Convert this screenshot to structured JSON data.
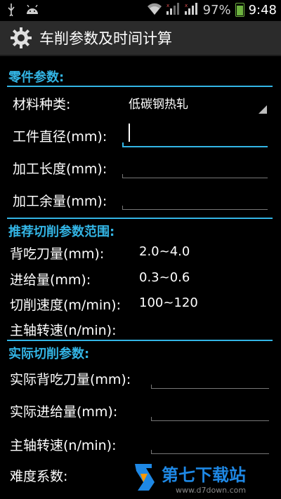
{
  "status": {
    "battery_pct": "97%",
    "time": "9:48"
  },
  "app": {
    "title": "车削参数及时间计算"
  },
  "parts": {
    "section_title": "零件参数:",
    "material_label": "材料种类:",
    "material_value": "低碳钢热轧",
    "diameter_label": "工件直径(mm):",
    "length_label": "加工长度(mm):",
    "allowance_label": "加工余量(mm):"
  },
  "recommended": {
    "section_title": "推荐切削参数范围:",
    "rows": [
      {
        "label": "背吃刀量(mm):",
        "value": "2.0~4.0"
      },
      {
        "label": "进给量(mm):",
        "value": "0.3~0.6"
      },
      {
        "label": "切削速度(m/min):",
        "value": "100~120"
      },
      {
        "label": "主轴转速(n/min):",
        "value": ""
      }
    ]
  },
  "actual": {
    "section_title": "实际切削参数:",
    "depth_label": "实际背吃刀量(mm):",
    "feed_label": "实际进给量(mm):",
    "speed_label": "主轴转速(n/min):",
    "difficulty_label": "难度系数:"
  },
  "watermark": {
    "brand": "第七下载站",
    "url": "www.d7down.com"
  },
  "colors": {
    "accent": "#33b5e5",
    "background": "#000000",
    "titlebar": "#2b2b2b",
    "battery": "#6db33f"
  }
}
